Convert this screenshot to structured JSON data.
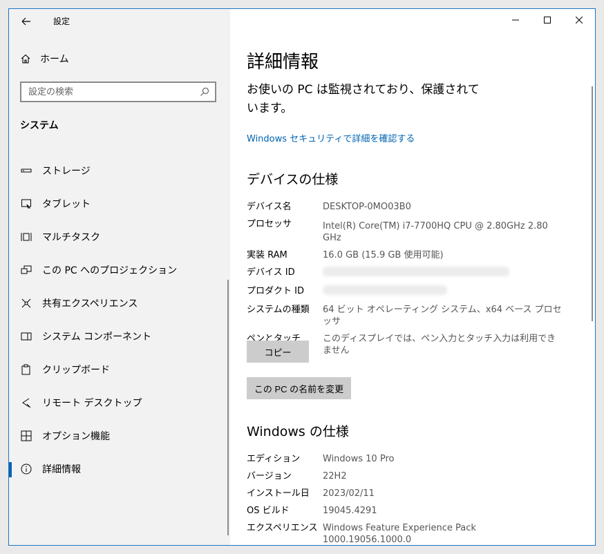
{
  "app": {
    "title": "設定"
  },
  "sidebar": {
    "home_label": "ホーム",
    "search_placeholder": "設定の検索",
    "section_title": "システム",
    "items": [
      {
        "label": "ストレージ",
        "icon": "storage-icon"
      },
      {
        "label": "タブレット",
        "icon": "tablet-icon"
      },
      {
        "label": "マルチタスク",
        "icon": "multitask-icon"
      },
      {
        "label": "この PC へのプロジェクション",
        "icon": "projection-icon"
      },
      {
        "label": "共有エクスペリエンス",
        "icon": "shared-experience-icon"
      },
      {
        "label": "システム コンポーネント",
        "icon": "system-components-icon"
      },
      {
        "label": "クリップボード",
        "icon": "clipboard-icon"
      },
      {
        "label": "リモート デスクトップ",
        "icon": "remote-desktop-icon"
      },
      {
        "label": "オプション機能",
        "icon": "optional-features-icon"
      },
      {
        "label": "詳細情報",
        "icon": "info-icon",
        "selected": true
      }
    ]
  },
  "main": {
    "title": "詳細情報",
    "protection_text": "お使いの PC は監視されており、保護されています。",
    "security_link": "Windows セキュリティで詳細を確認する",
    "device_specs": {
      "heading": "デバイスの仕様",
      "rows": [
        {
          "label": "デバイス名",
          "value": "DESKTOP-0MO03B0"
        },
        {
          "label": "プロセッサ",
          "value": "Intel(R) Core(TM) i7-7700HQ CPU @ 2.80GHz   2.80 GHz"
        },
        {
          "label": "実装 RAM",
          "value": "16.0 GB (15.9 GB 使用可能)"
        },
        {
          "label": "デバイス ID",
          "value": ""
        },
        {
          "label": "プロダクト ID",
          "value": ""
        },
        {
          "label": "システムの種類",
          "value": "64 ビット オペレーティング システム、x64 ベース プロセッサ"
        },
        {
          "label": "ペンとタッチ",
          "value": "このディスプレイでは、ペン入力とタッチ入力は利用できません"
        }
      ],
      "copy_button": "コピー",
      "rename_button": "この PC の名前を変更"
    },
    "windows_specs": {
      "heading": "Windows の仕様",
      "rows": [
        {
          "label": "エディション",
          "value": "Windows 10 Pro"
        },
        {
          "label": "バージョン",
          "value": "22H2"
        },
        {
          "label": "インストール日",
          "value": "2023/02/11"
        },
        {
          "label": "OS ビルド",
          "value": "19045.4291"
        },
        {
          "label": "エクスペリエンス",
          "value": "Windows Feature Experience Pack 1000.19056.1000.0"
        }
      ]
    }
  },
  "colors": {
    "accent": "#0063b1",
    "sidebar_bg": "#f2f2f2",
    "button_bg": "#cccccc",
    "window_border": "#1d74c2"
  }
}
